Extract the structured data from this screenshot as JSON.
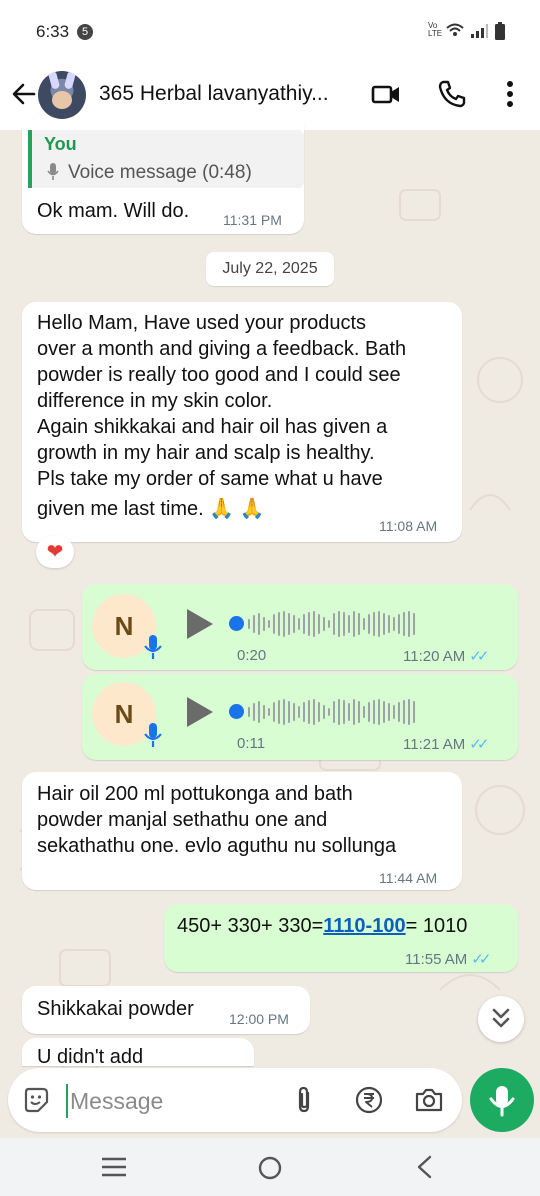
{
  "status_bar": {
    "time": "6:33",
    "notification_count": "5",
    "indicators": "Vo LTE"
  },
  "header": {
    "title": "365 Herbal lavanyathiy..."
  },
  "messages": {
    "m1": {
      "quote_author": "You",
      "quote_text": "Voice message (0:48)",
      "text": "Ok mam. Will do.",
      "time": "11:31 PM"
    },
    "date_chip": "July 22, 2025",
    "m2": {
      "lines": [
        "Hello Mam, Have used your products",
        "over a month and giving a feedback. Bath",
        "powder is really too good and I could see",
        "difference in my skin color.",
        "Again shikkakai and hair oil has given a",
        "growth in my hair and scalp is healthy.",
        "Pls take my order of same what u have",
        "given me last time. 🙏 🙏"
      ],
      "time": "11:08 AM",
      "reaction": "❤"
    },
    "v1": {
      "initial": "N",
      "duration": "0:20",
      "time": "11:20 AM",
      "progress": 0.0
    },
    "v2": {
      "initial": "N",
      "duration": "0:11",
      "time": "11:21 AM",
      "progress": 0.0
    },
    "m3": {
      "lines": [
        "Hair oil 200 ml pottukonga and bath",
        "powder manjal sethathu one and",
        "sekathathu one. evlo aguthu nu sollunga"
      ],
      "time": "11:44 AM"
    },
    "m4": {
      "prefix": "450+ 330+ 330=",
      "link": "1110-100",
      "suffix": "= 1010",
      "time": "11:55 AM"
    },
    "m5": {
      "text": "Shikkakai powder",
      "time": "12:00 PM"
    },
    "m6": {
      "text": "U didn't add"
    }
  },
  "composer": {
    "placeholder": "Message"
  },
  "icons": {
    "back": "arrow-left-icon",
    "video": "video-call-icon",
    "call": "phone-icon",
    "more": "more-vert-icon",
    "emoji": "sticker-icon",
    "attach": "paperclip-icon",
    "rupee": "rupee-payment-icon",
    "camera": "camera-icon",
    "mic": "mic-icon",
    "scroll": "chevron-double-down-icon"
  },
  "colors": {
    "accent": "#1daa61",
    "outgoing_bubble": "#d9fdd3",
    "incoming_bubble": "#ffffff",
    "read_tick": "#53bdeb",
    "link": "#0b5fbd"
  }
}
